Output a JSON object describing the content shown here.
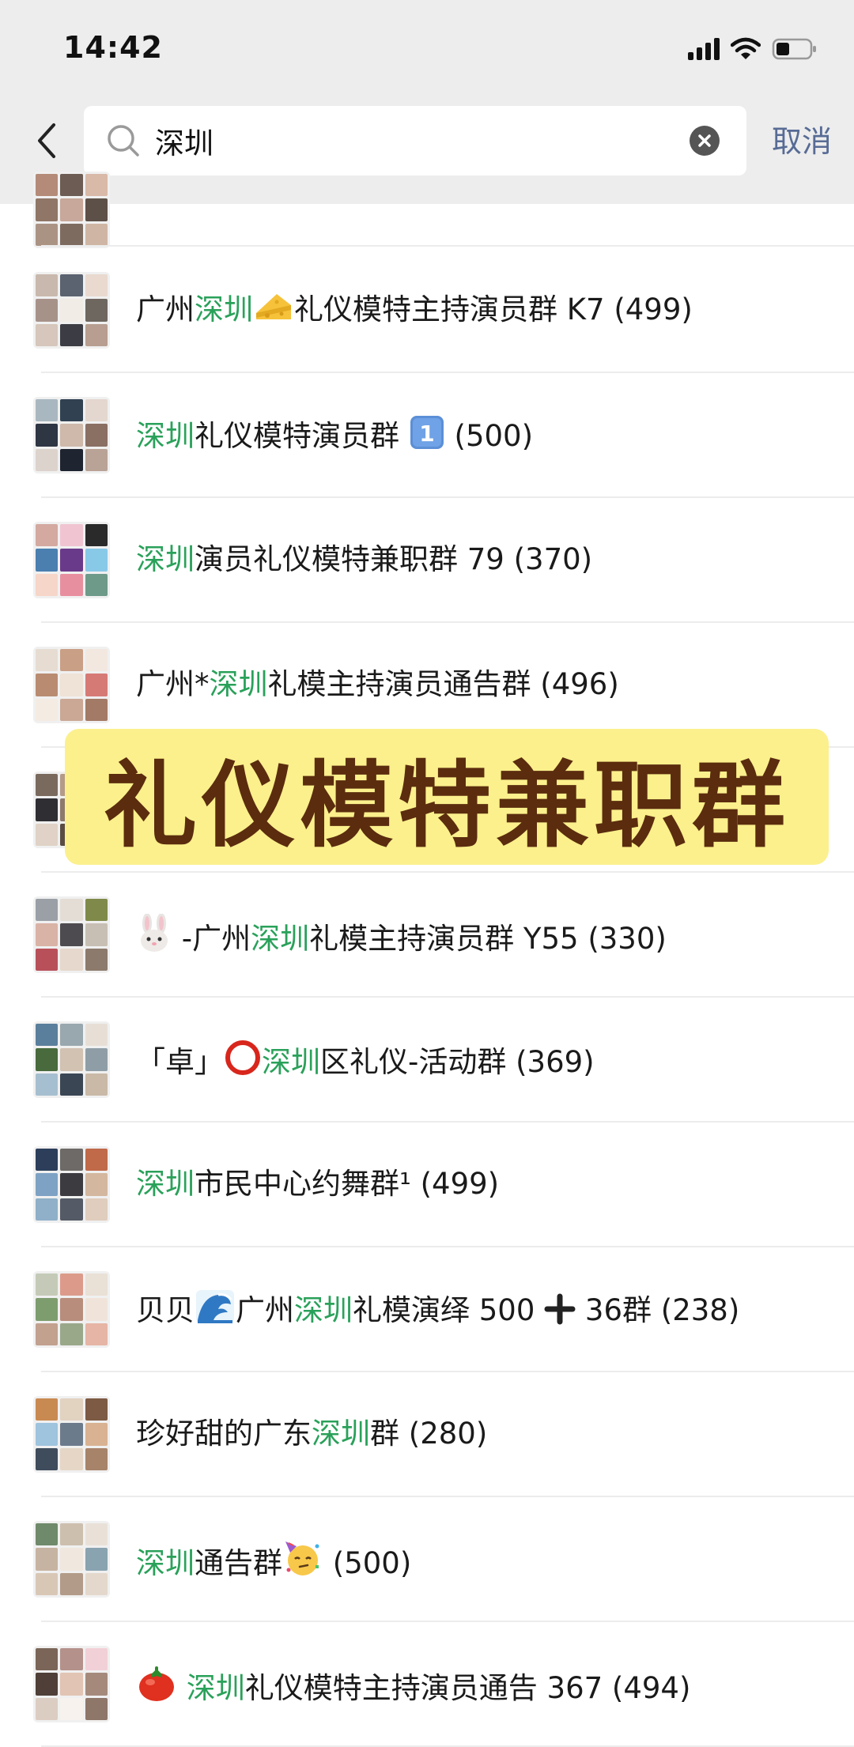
{
  "status_bar": {
    "time": "14:42"
  },
  "search": {
    "query": "深圳",
    "cancel_label": "取消"
  },
  "results": [
    {
      "parts": [
        {
          "t": "广州"
        },
        {
          "t": "深圳",
          "hl": true
        },
        {
          "emoji": "cheese"
        },
        {
          "t": "礼仪模特主持演员群 K7 (499)"
        }
      ]
    },
    {
      "parts": [
        {
          "t": "深圳",
          "hl": true
        },
        {
          "t": "礼仪模特演员群 "
        },
        {
          "emoji": "keycap-1"
        },
        {
          "t": " (500)"
        }
      ]
    },
    {
      "parts": [
        {
          "t": "深圳",
          "hl": true
        },
        {
          "t": "演员礼仪模特兼职群 79 (370)"
        }
      ]
    },
    {
      "parts": [
        {
          "t": "广州*"
        },
        {
          "t": "深圳",
          "hl": true
        },
        {
          "t": "礼模主持演员通告群 (496)"
        }
      ]
    },
    {
      "parts": []
    },
    {
      "parts": [
        {
          "emoji": "rabbit"
        },
        {
          "t": " -广州"
        },
        {
          "t": "深圳",
          "hl": true
        },
        {
          "t": "礼模主持演员群 Y55 (330)"
        }
      ]
    },
    {
      "parts": [
        {
          "t": "「卓」"
        },
        {
          "emoji": "red-circle"
        },
        {
          "t": "深圳",
          "hl": true
        },
        {
          "t": "区礼仪-活动群 (369)"
        }
      ]
    },
    {
      "parts": [
        {
          "t": "深圳",
          "hl": true
        },
        {
          "t": "市民中心约舞群¹ (499)"
        }
      ]
    },
    {
      "parts": [
        {
          "t": "贝贝"
        },
        {
          "emoji": "wave"
        },
        {
          "t": "广州"
        },
        {
          "t": "深圳",
          "hl": true
        },
        {
          "t": "礼模演绎 500 "
        },
        {
          "emoji": "plus"
        },
        {
          "t": " 36群 (238)"
        }
      ]
    },
    {
      "parts": [
        {
          "t": "珍好甜的广东"
        },
        {
          "t": "深圳",
          "hl": true
        },
        {
          "t": "群 (280)"
        }
      ]
    },
    {
      "parts": [
        {
          "t": "深圳",
          "hl": true
        },
        {
          "t": "通告群"
        },
        {
          "emoji": "party-face"
        },
        {
          "t": " (500)"
        }
      ]
    },
    {
      "parts": [
        {
          "emoji": "tomato"
        },
        {
          "t": " "
        },
        {
          "t": "深圳",
          "hl": true
        },
        {
          "t": "礼仪模特主持演员通告 367 (494)"
        }
      ]
    }
  ],
  "banner": {
    "text": "礼仪模特兼职群"
  },
  "colors": {
    "highlight": "#2aa15a",
    "link": "#576b95",
    "banner_bg": "#fbf08c",
    "banner_text": "#5b2c0e"
  }
}
